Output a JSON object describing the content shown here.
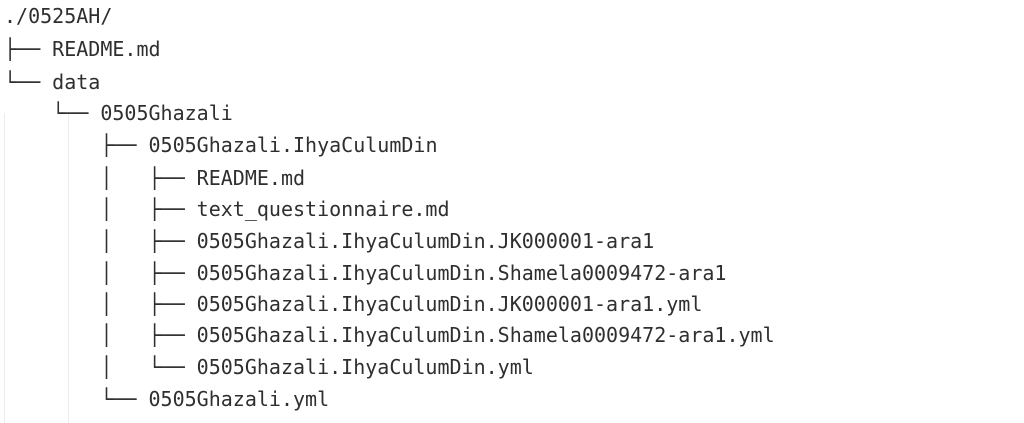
{
  "tree": {
    "lines": [
      {
        "connector": "",
        "name": "./0525AH/"
      },
      {
        "connector": "├── ",
        "name": "README.md"
      },
      {
        "connector": "└── ",
        "name": "data"
      },
      {
        "connector": "    └── ",
        "name": "0505Ghazali"
      },
      {
        "connector": "        ├── ",
        "name": "0505Ghazali.IhyaCulumDin"
      },
      {
        "connector": "        │   ├── ",
        "name": "README.md"
      },
      {
        "connector": "        │   ├── ",
        "name": "text_questionnaire.md"
      },
      {
        "connector": "        │   ├── ",
        "name": "0505Ghazali.IhyaCulumDin.JK000001-ara1"
      },
      {
        "connector": "        │   ├── ",
        "name": "0505Ghazali.IhyaCulumDin.Shamela0009472-ara1"
      },
      {
        "connector": "        │   ├── ",
        "name": "0505Ghazali.IhyaCulumDin.JK000001-ara1.yml"
      },
      {
        "connector": "        │   ├── ",
        "name": "0505Ghazali.IhyaCulumDin.Shamela0009472-ara1.yml"
      },
      {
        "connector": "        │   └── ",
        "name": "0505Ghazali.IhyaCulumDin.yml"
      },
      {
        "connector": "        └── ",
        "name": "0505Ghazali.yml"
      }
    ]
  }
}
